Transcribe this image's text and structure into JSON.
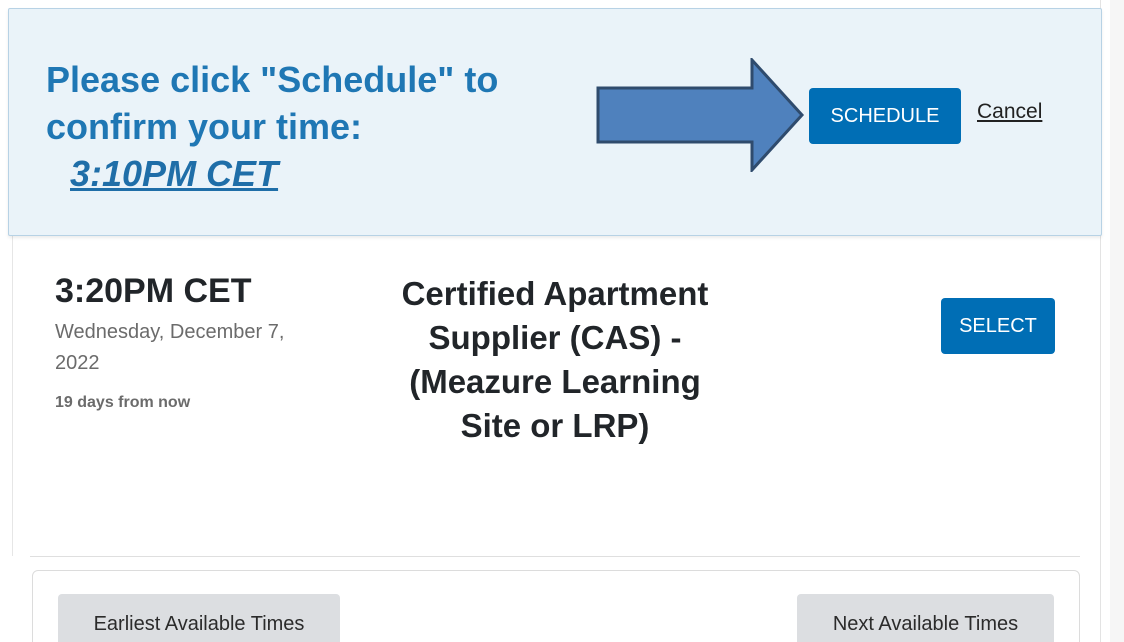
{
  "confirm": {
    "message": "Please click \"Schedule\" to confirm your time:",
    "time": "3:10PM CET",
    "schedule_label": "SCHEDULE",
    "cancel_label": "Cancel",
    "arrow_icon": "right-arrow-icon",
    "colors": {
      "banner_bg": "#eaf3f9",
      "message": "#1f77b4",
      "arrow_fill": "#4f81bd",
      "arrow_stroke": "#2f4b6d"
    }
  },
  "slot": {
    "time": "3:20PM CET",
    "date": "Wednesday, December 7, 2022",
    "relative": "19 days from now",
    "title": "Certified Apartment Supplier (CAS) - (Meazure Learning Site or LRP)",
    "select_label": "SELECT"
  },
  "nav": {
    "earliest_label": "Earliest Available Times",
    "next_label": "Next Available Times"
  },
  "colors": {
    "primary": "#006eb5",
    "gray_button": "#dcdee1"
  }
}
